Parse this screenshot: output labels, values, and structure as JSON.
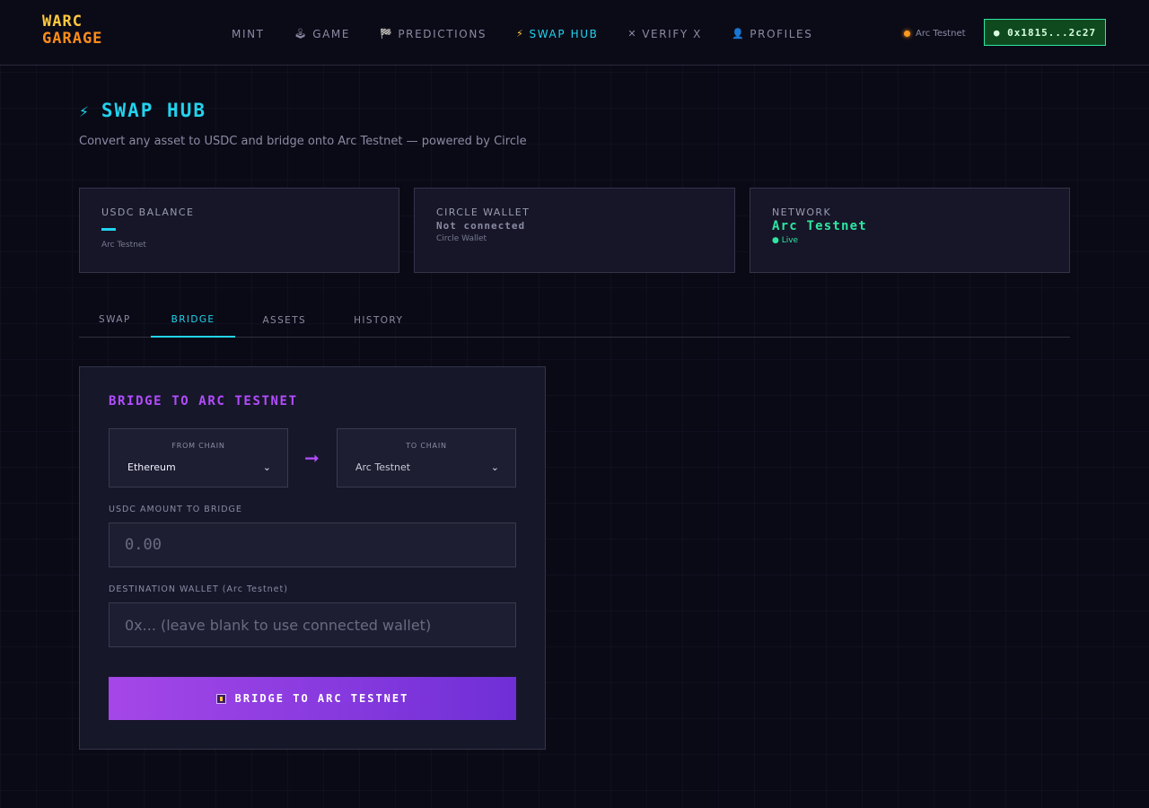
{
  "header": {
    "logo_line1": "WARC",
    "logo_line2": "GARAGE",
    "nav": [
      {
        "label": "MINT",
        "icon": ""
      },
      {
        "label": "GAME",
        "icon": "🕹"
      },
      {
        "label": "PREDICTIONS",
        "icon": "🏁"
      },
      {
        "label": "SWAP HUB",
        "icon": "⚡"
      },
      {
        "label": "VERIFY X",
        "icon": "✕"
      },
      {
        "label": "PROFILES",
        "icon": "👤"
      }
    ],
    "network_indicator": "Arc Testnet",
    "wallet_button": "● 0x1815...2c27"
  },
  "page": {
    "title_icon": "⚡",
    "title": "SWAP HUB",
    "subtitle": "Convert any asset to USDC and bridge onto Arc Testnet — powered by Circle"
  },
  "cards": {
    "usdc": {
      "label": "USDC BALANCE",
      "sub": "Arc Testnet"
    },
    "circle": {
      "label": "CIRCLE WALLET",
      "value": "Not connected",
      "sub": "Circle Wallet"
    },
    "network": {
      "label": "NETWORK",
      "value": "Arc Testnet",
      "status": "● Live"
    }
  },
  "tabs": [
    "SWAP",
    "BRIDGE",
    "ASSETS",
    "HISTORY"
  ],
  "bridge": {
    "title": "BRIDGE TO ARC TESTNET",
    "from_label": "FROM CHAIN",
    "from_value": "Ethereum",
    "to_label": "TO CHAIN",
    "to_value": "Arc Testnet",
    "amount_label": "USDC AMOUNT TO BRIDGE",
    "amount_placeholder": "0.00",
    "dest_label": "DESTINATION WALLET (Arc Testnet)",
    "dest_placeholder": "0x... (leave blank to use connected wallet)",
    "button_label": "BRIDGE TO ARC TESTNET"
  },
  "colors": {
    "accent_cyan": "#22d3ee",
    "accent_purple": "#b34dff",
    "accent_green": "#2ee6a0",
    "logo_yellow": "#ffc83d",
    "logo_orange": "#ff8c1a"
  }
}
